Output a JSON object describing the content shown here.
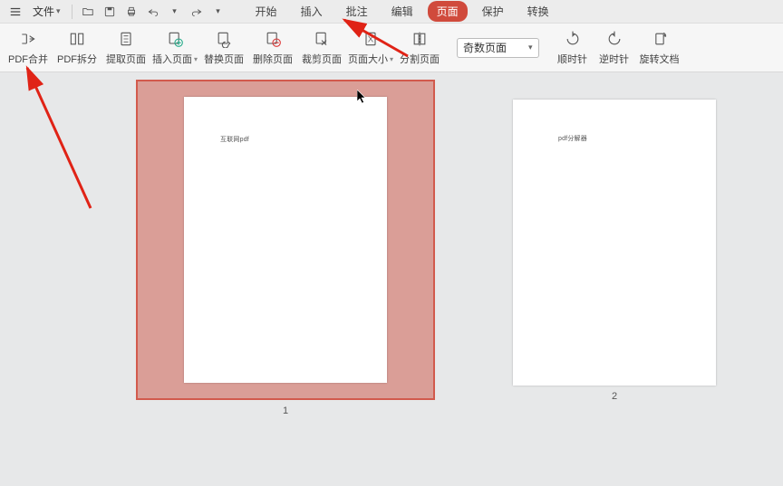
{
  "header": {
    "file_label": "文件",
    "tabs": [
      {
        "label": "开始",
        "active": false
      },
      {
        "label": "插入",
        "active": false
      },
      {
        "label": "批注",
        "active": false
      },
      {
        "label": "编辑",
        "active": false
      },
      {
        "label": "页面",
        "active": true
      },
      {
        "label": "保护",
        "active": false
      },
      {
        "label": "转换",
        "active": false
      }
    ],
    "qa_icons": [
      "open-icon",
      "save-icon",
      "print-icon",
      "undo-icon",
      "redo-icon"
    ]
  },
  "toolbar": {
    "buttons": [
      {
        "label": "PDF合并",
        "dd": false,
        "name": "pdf-merge-button",
        "icon": "merge"
      },
      {
        "label": "PDF拆分",
        "dd": false,
        "name": "pdf-split-button",
        "icon": "split"
      },
      {
        "label": "提取页面",
        "dd": false,
        "name": "extract-pages-button",
        "icon": "extract"
      },
      {
        "label": "插入页面",
        "dd": true,
        "name": "insert-pages-button",
        "icon": "insert"
      },
      {
        "label": "替换页面",
        "dd": false,
        "name": "replace-pages-button",
        "icon": "replace"
      },
      {
        "label": "删除页面",
        "dd": false,
        "name": "delete-pages-button",
        "icon": "delete"
      },
      {
        "label": "裁剪页面",
        "dd": false,
        "name": "crop-pages-button",
        "icon": "crop"
      },
      {
        "label": "页面大小",
        "dd": true,
        "name": "page-size-button",
        "icon": "size"
      },
      {
        "label": "分割页面",
        "dd": false,
        "name": "split-page-button",
        "icon": "cut"
      }
    ],
    "page_select": "奇数页面",
    "rotate": [
      {
        "label": "顺时针",
        "name": "rotate-cw-button",
        "icon": "cw"
      },
      {
        "label": "逆时针",
        "name": "rotate-ccw-button",
        "icon": "ccw"
      },
      {
        "label": "旋转文档",
        "name": "rotate-doc-button",
        "icon": "rotdoc"
      }
    ]
  },
  "pages": {
    "1": {
      "num": "1",
      "text": "互联网pdf"
    },
    "2": {
      "num": "2",
      "text": "pdf分解器"
    }
  },
  "colors": {
    "accent": "#d04a3c",
    "selection": "#da9e97",
    "arrow": "#e02316"
  }
}
